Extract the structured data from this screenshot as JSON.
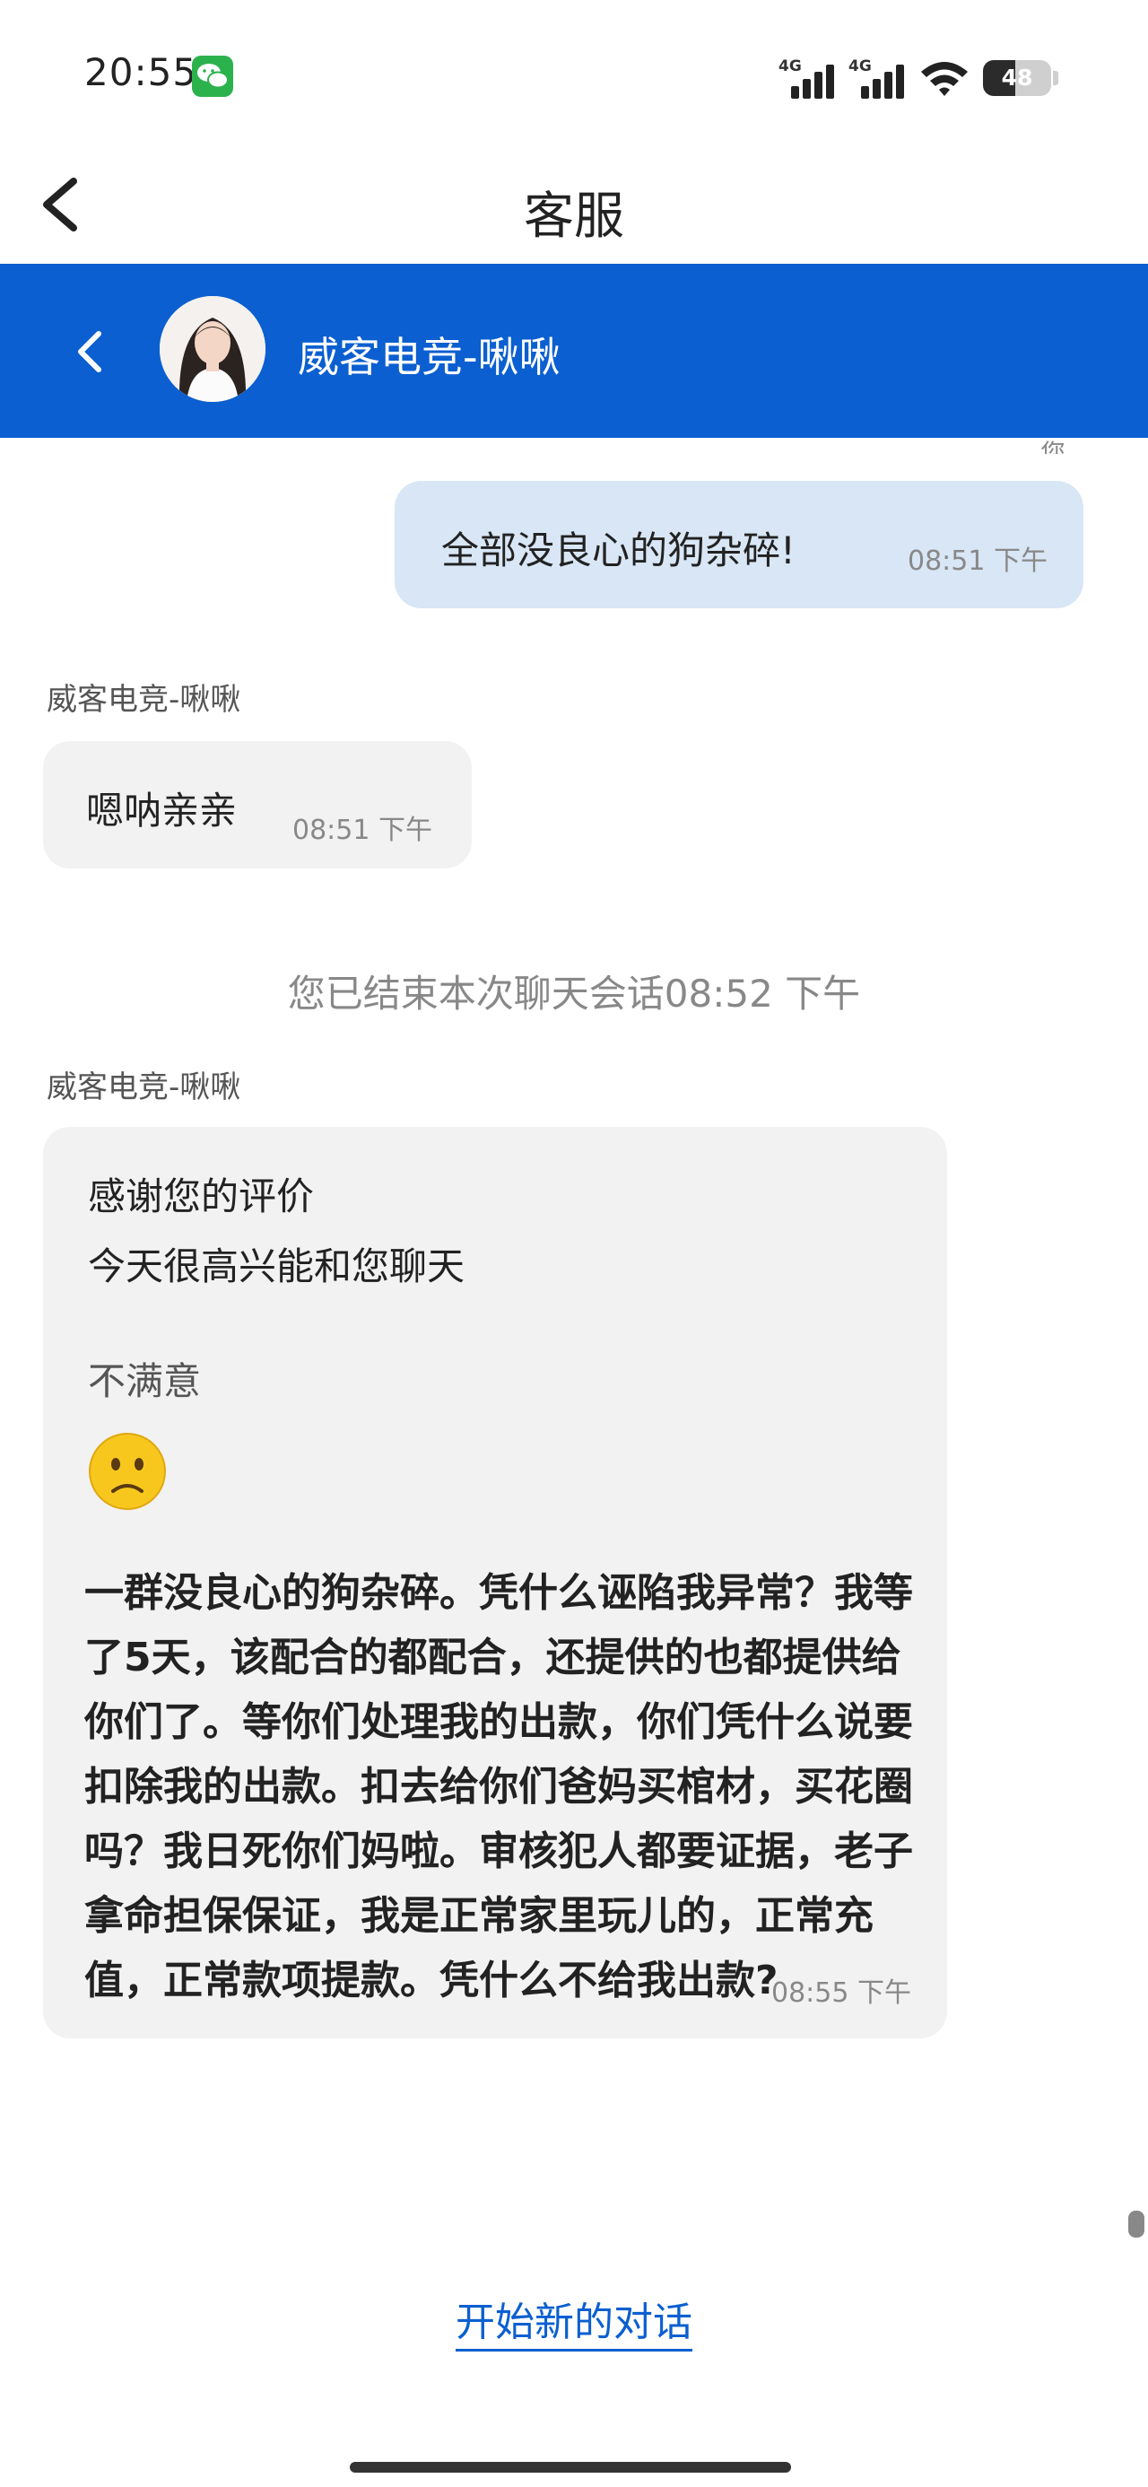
{
  "status_bar": {
    "time": "20:55",
    "network_1": "4G",
    "network_2": "4G",
    "battery_level": "48",
    "battery_fraction": 0.48
  },
  "app_header": {
    "title": "客服"
  },
  "chat_header": {
    "agent_name": "威客电竞-啾啾",
    "accent_color": "#0b5fd0"
  },
  "messages": {
    "cut_glyph": "您",
    "outgoing_1": {
      "text": "全部没良心的狗杂碎!",
      "time": "08:51 下午"
    },
    "incoming_1": {
      "sender": "威客电竞-啾啾",
      "text": "嗯呐亲亲",
      "time": "08:51 下午"
    },
    "system": "您已结束本次聊天会话08:52 下午",
    "incoming_2": {
      "sender": "威客电竞-啾啾",
      "line1": "感谢您的评价",
      "line2": "今天很高兴能和您聊天",
      "rating": "不满意",
      "rating_icon": "frown-emoji-icon",
      "body": "一群没良心的狗杂碎。凭什么诬陷我异常？我等了5天，该配合的都配合，还提供的也都提供给你们了。等你们处理我的出款，你们凭什么说要扣除我的出款。扣去给你们爸妈买棺材，买花圈吗？我日死你们妈啦。审核犯人都要证据，老子拿命担保保证，我是正常家里玩儿的，正常充值，正常款项提款。凭什么不给我出款?",
      "time": "08:55 下午"
    }
  },
  "footer": {
    "new_conversation": "开始新的对话"
  }
}
